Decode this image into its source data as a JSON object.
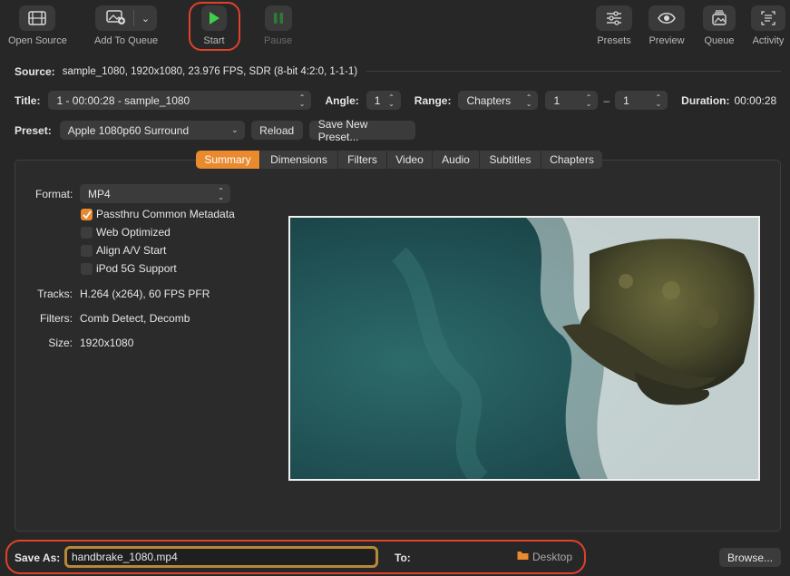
{
  "toolbar": {
    "open_source": "Open Source",
    "add_to_queue": "Add To Queue",
    "start": "Start",
    "pause": "Pause",
    "presets": "Presets",
    "preview": "Preview",
    "queue": "Queue",
    "activity": "Activity"
  },
  "source": {
    "label": "Source:",
    "value": "sample_1080, 1920x1080, 23.976 FPS, SDR (8-bit 4:2:0, 1-1-1)"
  },
  "title_row": {
    "title_label": "Title:",
    "title_value": "1 - 00:00:28 - sample_1080",
    "angle_label": "Angle:",
    "angle_value": "1",
    "range_label": "Range:",
    "range_value": "Chapters",
    "range_start": "1",
    "range_sep": "–",
    "range_end": "1",
    "duration_label": "Duration:",
    "duration_value": "00:00:28"
  },
  "preset_row": {
    "label": "Preset:",
    "value": "Apple 1080p60 Surround",
    "reload": "Reload",
    "save_new": "Save New Preset..."
  },
  "tabs": [
    "Summary",
    "Dimensions",
    "Filters",
    "Video",
    "Audio",
    "Subtitles",
    "Chapters"
  ],
  "summary": {
    "format_label": "Format:",
    "format_value": "MP4",
    "options": [
      {
        "label": "Passthru Common Metadata",
        "checked": true
      },
      {
        "label": "Web Optimized",
        "checked": false
      },
      {
        "label": "Align A/V Start",
        "checked": false
      },
      {
        "label": "iPod 5G Support",
        "checked": false
      }
    ],
    "tracks_label": "Tracks:",
    "tracks_value": "H.264 (x264), 60 FPS PFR",
    "filters_label": "Filters:",
    "filters_value": "Comb Detect, Decomb",
    "size_label": "Size:",
    "size_value": "1920x1080"
  },
  "save": {
    "label": "Save As:",
    "filename": "handbrake_1080.mp4",
    "to_label": "To:",
    "destination": "Desktop",
    "browse": "Browse..."
  },
  "colors": {
    "accent": "#e98a2f",
    "highlight": "#e0412b",
    "start_green": "#3fcf4a"
  }
}
